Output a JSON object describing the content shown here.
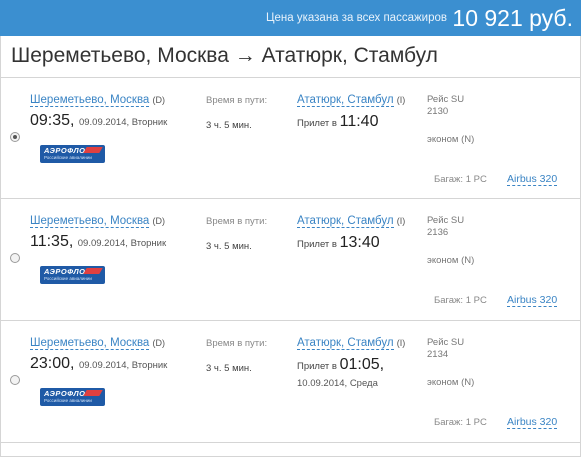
{
  "price": {
    "caption": "Цена указана за всех пассажиров",
    "amount": "10 921 руб."
  },
  "route": {
    "title": "Шереметьево, Москва → Ататюрк, Стамбул"
  },
  "labels": {
    "travel_time": "Время в пути:",
    "arrival_prefix": "Прилет в",
    "baggage": "Багаж: 1 PC"
  },
  "options": [
    {
      "selected": true,
      "dep_airport": "Шереметьево, Москва",
      "dep_code": "(D)",
      "dep_time": "09:35",
      "dep_date": "09.09.2014, Вторник",
      "airline_logo": "АЭРОФЛОТ",
      "airline_logo_sub": "Российские авиалинии",
      "duration": "3 ч. 5 мин.",
      "arr_airport": "Ататюрк, Стамбул",
      "arr_code": "(I)",
      "arr_time": "11:40",
      "arr_date": "",
      "flight_label": "Рейс SU",
      "flight_number": "2130",
      "cabin": "эконом (N)",
      "aircraft": "Airbus 320"
    },
    {
      "selected": false,
      "dep_airport": "Шереметьево, Москва",
      "dep_code": "(D)",
      "dep_time": "11:35",
      "dep_date": "09.09.2014, Вторник",
      "airline_logo": "АЭРОФЛОТ",
      "airline_logo_sub": "Российские авиалинии",
      "duration": "3 ч. 5 мин.",
      "arr_airport": "Ататюрк, Стамбул",
      "arr_code": "(I)",
      "arr_time": "13:40",
      "arr_date": "",
      "flight_label": "Рейс SU",
      "flight_number": "2136",
      "cabin": "эконом (N)",
      "aircraft": "Airbus 320"
    },
    {
      "selected": false,
      "dep_airport": "Шереметьево, Москва",
      "dep_code": "(D)",
      "dep_time": "23:00",
      "dep_date": "09.09.2014, Вторник",
      "airline_logo": "АЭРОФЛОТ",
      "airline_logo_sub": "Российские авиалинии",
      "duration": "3 ч. 5 мин.",
      "arr_airport": "Ататюрк, Стамбул",
      "arr_code": "(I)",
      "arr_time": "01:05",
      "arr_date": "10.09.2014, Среда",
      "flight_label": "Рейс SU",
      "flight_number": "2134",
      "cabin": "эконом (N)",
      "aircraft": "Airbus 320"
    }
  ]
}
